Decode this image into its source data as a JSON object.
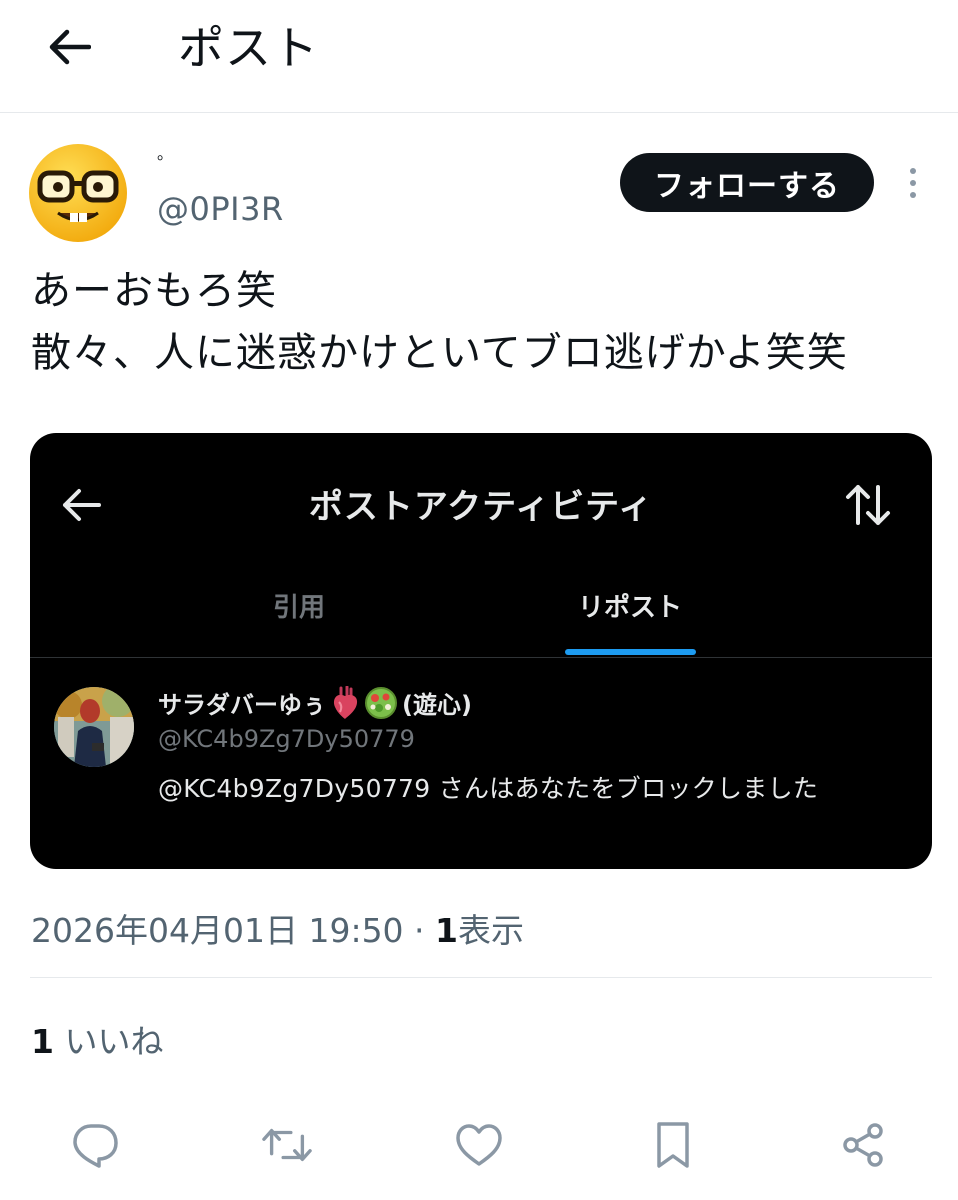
{
  "header": {
    "title": "ポスト",
    "back_icon": "arrow-left-icon"
  },
  "post": {
    "display_name": "。",
    "handle": "@0PI3R",
    "avatar": "nerd-face-emoji",
    "follow_label": "フォローする",
    "more_icon": "vertical-dots-icon",
    "text_lines": [
      "あーおもろ笑",
      "散々、人に迷惑かけといてブロ逃げかよ笑笑"
    ]
  },
  "embed": {
    "title": "ポストアクティビティ",
    "back_icon": "arrow-left-icon",
    "sort_icon": "sort-arrows-icon",
    "tabs": [
      {
        "label": "引用",
        "active": false
      },
      {
        "label": "リポスト",
        "active": true
      }
    ],
    "user": {
      "name": "サラダバーゆぅ",
      "name_suffix": "(遊心)",
      "handle": "@KC4b9Zg7Dy50779",
      "message": "@KC4b9Zg7Dy50779 さんはあなたをブロックしました"
    }
  },
  "meta": {
    "timestamp": "2026年04月01日 19:50",
    "separator": " · ",
    "views_count": "1",
    "views_label": "表示"
  },
  "likes": {
    "count": "1",
    "label": "いいね"
  },
  "actions": [
    "reply-icon",
    "repost-icon",
    "like-icon",
    "bookmark-icon",
    "share-icon"
  ],
  "colors": {
    "accent": "#1d9bf0",
    "text": "#0f1419",
    "secondary": "#536471",
    "dark_bg": "#000000"
  }
}
